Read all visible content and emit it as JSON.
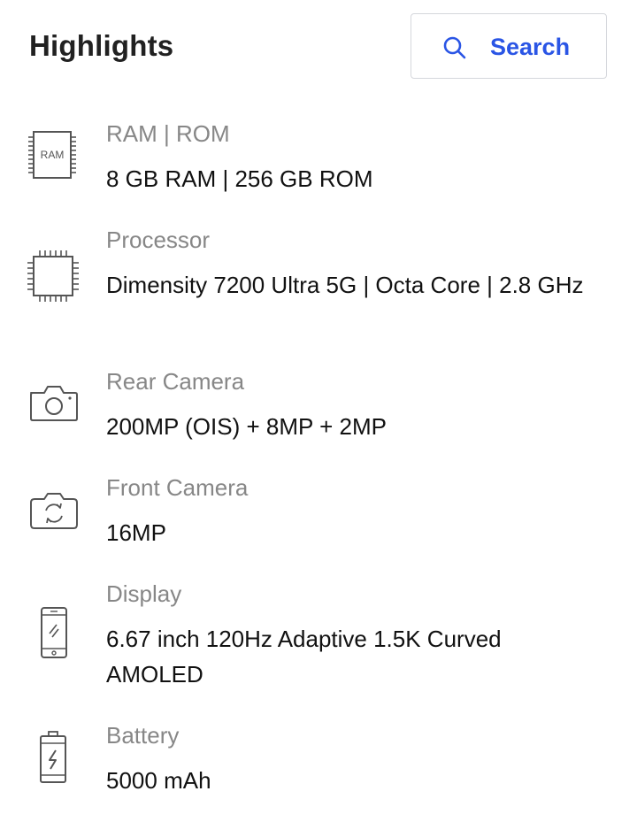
{
  "header": {
    "title": "Highlights",
    "search_label": "Search",
    "search_icon": "search-icon",
    "accent_color": "#2a55e5"
  },
  "specs": [
    {
      "label": "RAM | ROM",
      "value": "8 GB RAM | 256 GB ROM",
      "icon": "ram-chip-icon",
      "icon_text": "RAM"
    },
    {
      "label": "Processor",
      "value": "Dimensity 7200 Ultra 5G | Octa Core | 2.8 GHz",
      "icon": "processor-chip-icon"
    },
    {
      "label": "Rear Camera",
      "value": "200MP (OIS) + 8MP + 2MP",
      "icon": "camera-icon"
    },
    {
      "label": "Front Camera",
      "value": "16MP",
      "icon": "front-camera-icon"
    },
    {
      "label": "Display",
      "value": "6.67 inch 120Hz Adaptive 1.5K Curved AMOLED",
      "icon": "phone-display-icon"
    },
    {
      "label": "Battery",
      "value": "5000 mAh",
      "icon": "battery-icon"
    }
  ]
}
